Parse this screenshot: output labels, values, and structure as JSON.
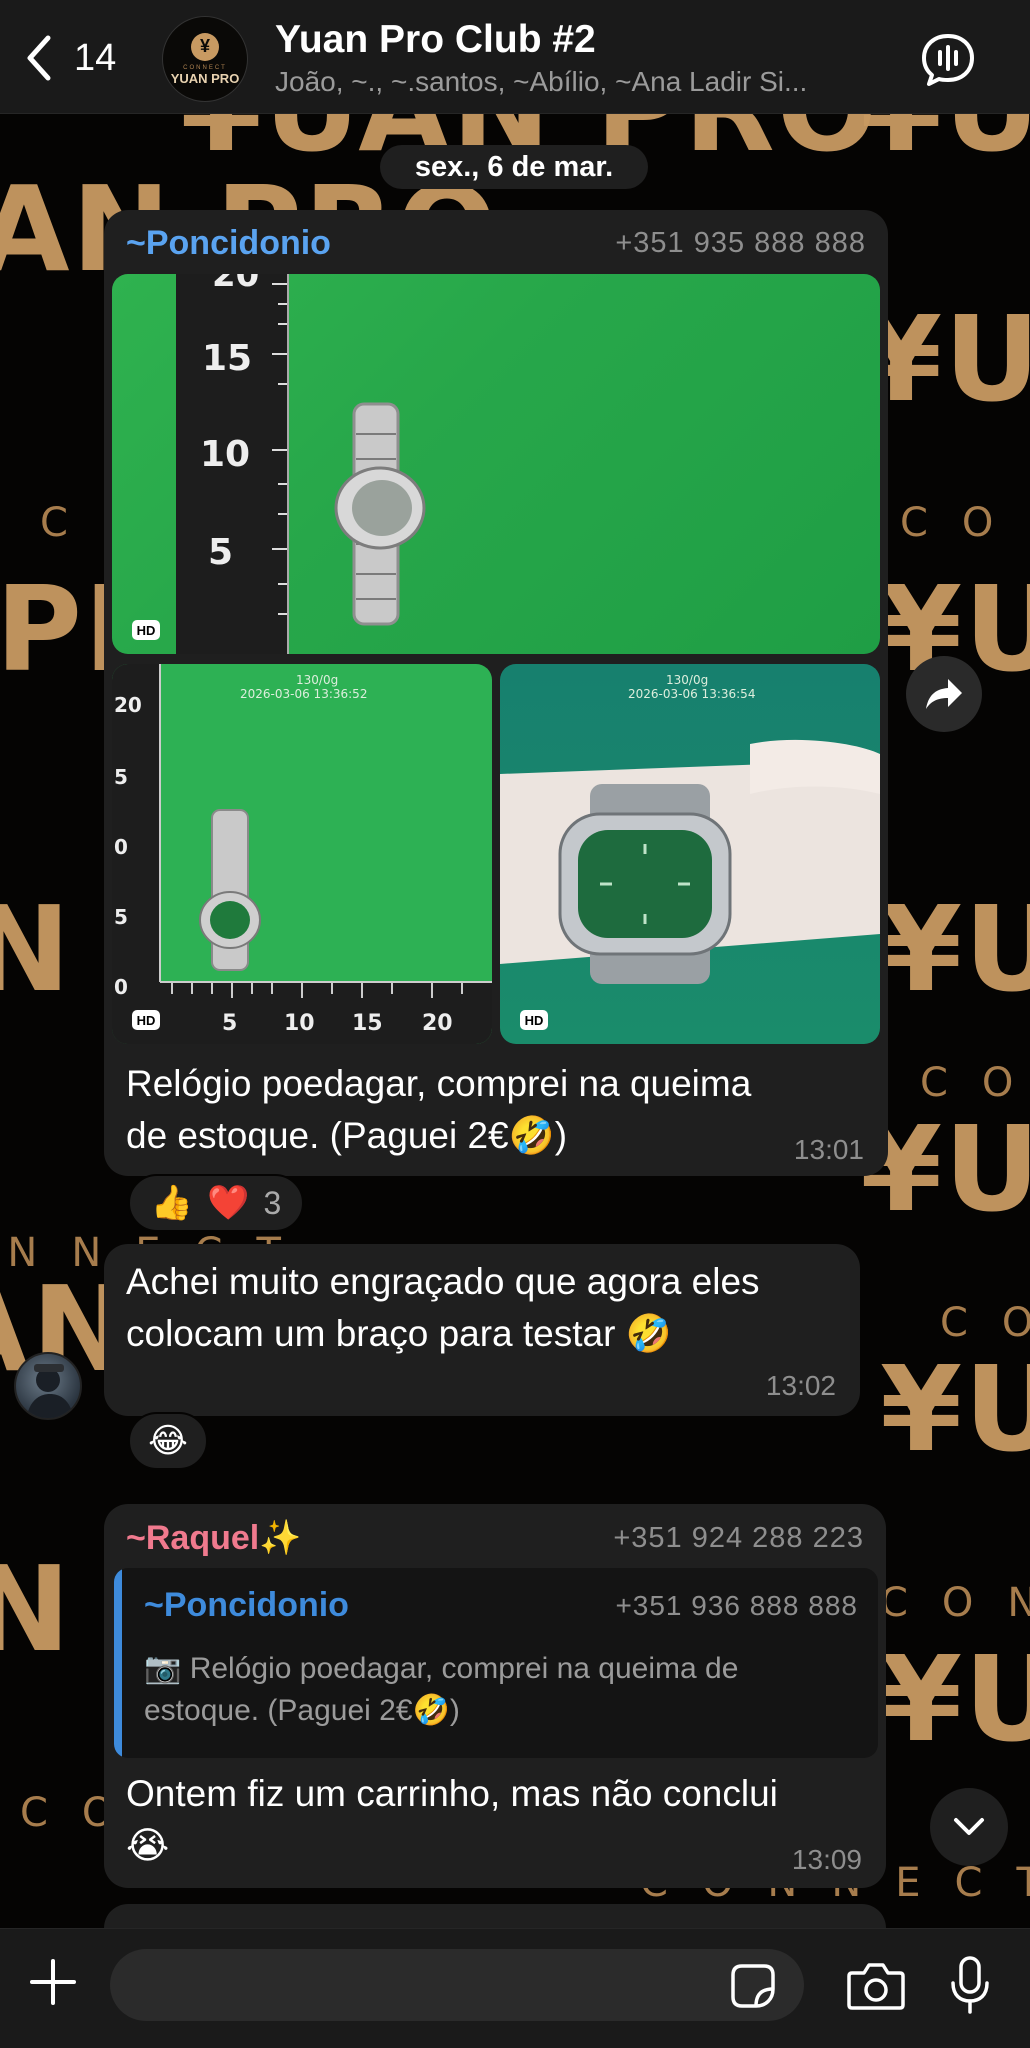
{
  "header": {
    "back_count": "14",
    "title": "Yuan Pro Club #2",
    "subtitle": "João, ~., ~.santos, ~Abílio, ~Ana Ladir Si...",
    "avatar_text": "YUAN PRO",
    "avatar_small": "CONNECT"
  },
  "date_pill": "sex., 6 de mar.",
  "wallpaper": {
    "brand": "¥UAN PRO",
    "tagline": "CONNECT",
    "accent": "#c89a62"
  },
  "messages": [
    {
      "sender": "~Poncidonio",
      "sender_color": "#5aa3f0",
      "phone": "+351 935 888 888",
      "photos": [
        {
          "hd": "HD",
          "ruler": [
            "20",
            "15",
            "10",
            "5"
          ]
        },
        {
          "hd": "HD",
          "caption": "130/0g",
          "timestamp": "2026-03-06 13:36:52",
          "ruler": [
            "20",
            "5",
            "0",
            "5",
            "0"
          ],
          "ruler_x": [
            "5",
            "10",
            "15",
            "20"
          ]
        },
        {
          "hd": "HD",
          "caption": "130/0g",
          "timestamp": "2026-03-06 13:36:54"
        }
      ],
      "text_line1": "Relógio poedagar, comprei na queima",
      "text_line2": "de estoque. (Paguei 2€🤣)",
      "time": "13:01",
      "reactions": [
        "👍",
        "❤️"
      ],
      "reaction_count": "3"
    },
    {
      "text_line1": "Achei muito engraçado que agora eles",
      "text_line2": "colocam um braço para testar 🤣",
      "time": "13:02",
      "reactions": [
        "😂"
      ]
    },
    {
      "sender": "~Raquel✨",
      "sender_color": "#f07a8e",
      "phone": "+351 924 288 223",
      "quote": {
        "sender": "~Poncidonio",
        "phone": "+351 936 888 888",
        "text_line1": "📷 Relógio poedagar, comprei na queima de",
        "text_line2": "estoque. (Paguei 2€🤣)"
      },
      "text_line1": "Ontem fiz um carrinho, mas não conclui",
      "text_line2": "😭",
      "time": "13:09"
    }
  ],
  "input": {
    "placeholder": ""
  },
  "icons": {
    "back": "chevron-left-icon",
    "call": "voice-call-icon",
    "forward": "forward-icon",
    "scroll": "chevron-down-icon",
    "attach": "plus-icon",
    "sticker": "sticker-icon",
    "camera": "camera-icon",
    "mic": "microphone-icon"
  }
}
